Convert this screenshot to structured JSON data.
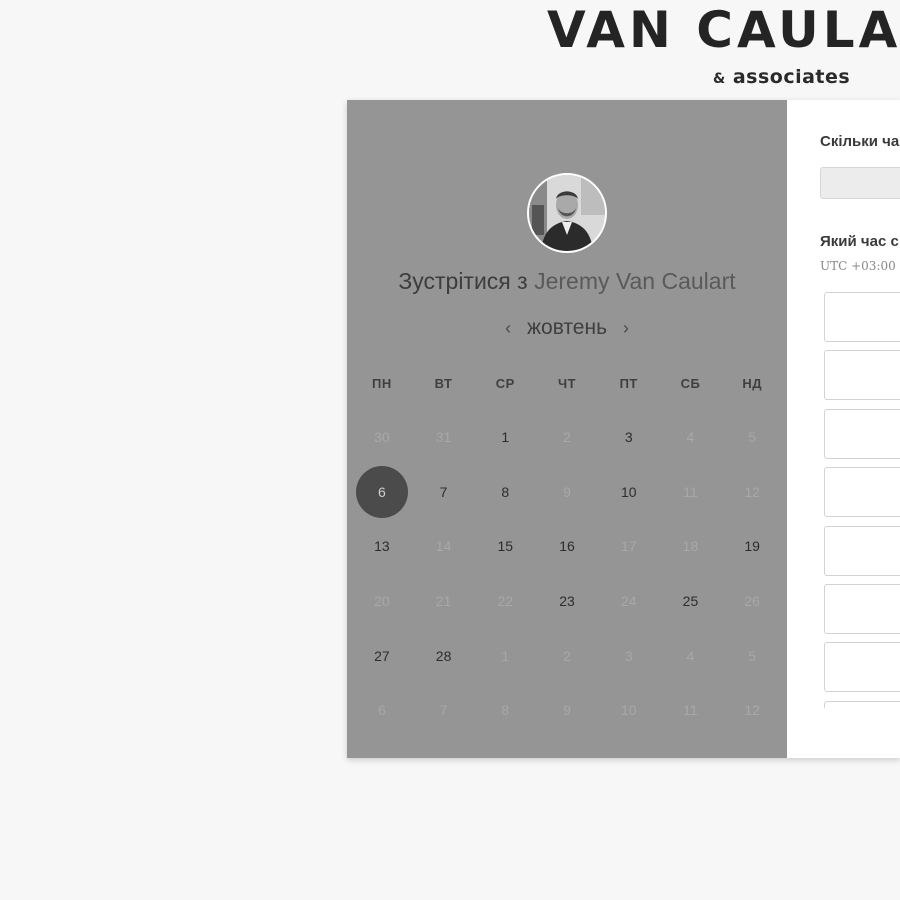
{
  "brand": {
    "title": "VAN CAULART",
    "subtitle_amp": "&",
    "subtitle_text": "associates"
  },
  "scheduler": {
    "meet_prefix": "Зустрітися з",
    "host_name": "Jeremy Van Caulart",
    "month": "жовтень",
    "prev_arrow": "‹",
    "next_arrow": "›",
    "weekdays": [
      "ПН",
      "ВТ",
      "СР",
      "ЧТ",
      "ПТ",
      "СБ",
      "НД"
    ],
    "weeks": [
      [
        {
          "d": "30",
          "a": false
        },
        {
          "d": "31",
          "a": false
        },
        {
          "d": "1",
          "a": true
        },
        {
          "d": "2",
          "a": false
        },
        {
          "d": "3",
          "a": true
        },
        {
          "d": "4",
          "a": false
        },
        {
          "d": "5",
          "a": false
        }
      ],
      [
        {
          "d": "6",
          "a": true,
          "selected": true
        },
        {
          "d": "7",
          "a": true
        },
        {
          "d": "8",
          "a": true
        },
        {
          "d": "9",
          "a": false
        },
        {
          "d": "10",
          "a": true
        },
        {
          "d": "11",
          "a": false
        },
        {
          "d": "12",
          "a": false
        }
      ],
      [
        {
          "d": "13",
          "a": true
        },
        {
          "d": "14",
          "a": false
        },
        {
          "d": "15",
          "a": true
        },
        {
          "d": "16",
          "a": true
        },
        {
          "d": "17",
          "a": false
        },
        {
          "d": "18",
          "a": false
        },
        {
          "d": "19",
          "a": true
        }
      ],
      [
        {
          "d": "20",
          "a": false
        },
        {
          "d": "21",
          "a": false
        },
        {
          "d": "22",
          "a": false
        },
        {
          "d": "23",
          "a": true
        },
        {
          "d": "24",
          "a": false
        },
        {
          "d": "25",
          "a": true
        },
        {
          "d": "26",
          "a": false
        }
      ],
      [
        {
          "d": "27",
          "a": true
        },
        {
          "d": "28",
          "a": true
        },
        {
          "d": "1",
          "a": false
        },
        {
          "d": "2",
          "a": false
        },
        {
          "d": "3",
          "a": false
        },
        {
          "d": "4",
          "a": false
        },
        {
          "d": "5",
          "a": false
        }
      ],
      [
        {
          "d": "6",
          "a": false
        },
        {
          "d": "7",
          "a": false
        },
        {
          "d": "8",
          "a": false
        },
        {
          "d": "9",
          "a": false
        },
        {
          "d": "10",
          "a": false
        },
        {
          "d": "11",
          "a": false
        },
        {
          "d": "12",
          "a": false
        }
      ]
    ]
  },
  "booking": {
    "duration_question": "Скільки ча",
    "time_question": "Який час с",
    "timezone": "UTC +03:00",
    "time_slots": [
      "",
      "",
      "",
      "",
      "",
      "",
      "",
      ""
    ]
  },
  "colors": {
    "left_panel": "#959595",
    "selected_day": "#4b4b4b",
    "background": "#f7f7f7"
  }
}
